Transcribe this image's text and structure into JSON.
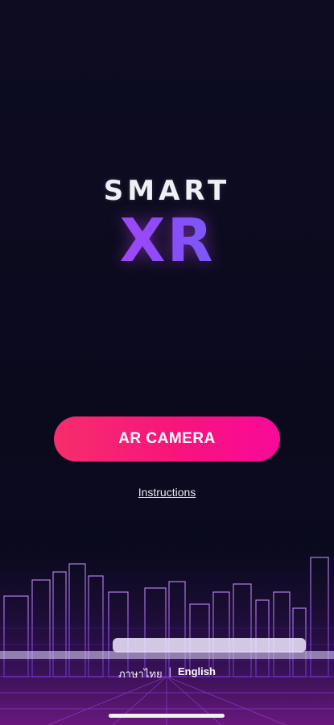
{
  "logo": {
    "line1": "SMART",
    "line2": "XR"
  },
  "actions": {
    "ar_camera_label": "AR CAMERA",
    "instructions_label": "Instructions"
  },
  "language": {
    "thai_label": "ภาษาไทย",
    "separator": "|",
    "english_label": "English",
    "selected": "English"
  },
  "colors": {
    "background": "#0c0b1e",
    "button_gradient_start": "#f52e6b",
    "button_gradient_end": "#f80a99",
    "logo_gradient_start": "#d13cf6",
    "logo_gradient_end": "#4f7ff5"
  }
}
